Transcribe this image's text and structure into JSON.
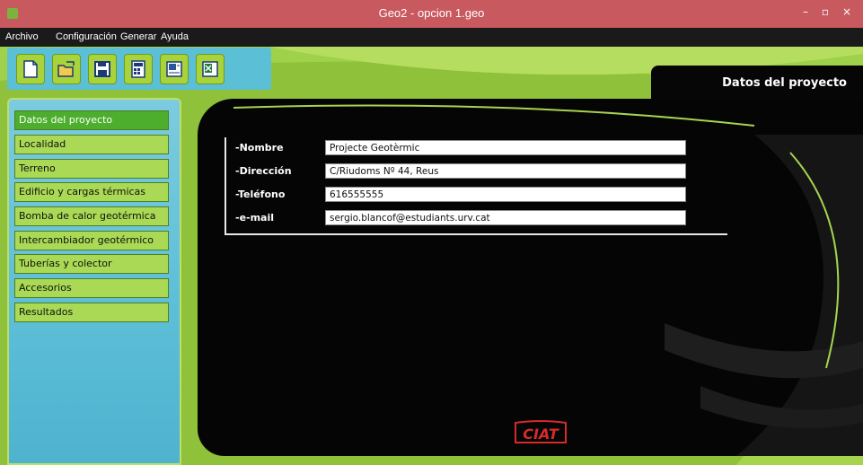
{
  "window": {
    "title": "Geo2 - opcion 1.geo"
  },
  "menu": [
    "Archivo",
    "Configuración",
    "Generar",
    "Ayuda"
  ],
  "toolbar": {
    "buttons": [
      "new-file-icon",
      "open-folder-icon",
      "save-icon",
      "calculator-icon",
      "word-export-icon",
      "excel-export-icon"
    ]
  },
  "section_tab": "Datos del proyecto",
  "sidebar": {
    "items": [
      "Datos del proyecto",
      "Localidad",
      "Terreno",
      "Edificio y cargas térmicas",
      "Bomba de calor geotérmica",
      "Intercambiador geotérmico",
      "Tuberías y colector",
      "Accesorios",
      "Resultados"
    ],
    "active_index": 0
  },
  "form": {
    "nombre_label": "-Nombre",
    "nombre_value": "Projecte Geotèrmic",
    "direccion_label": "-Dirección",
    "direccion_value": "C/Riudoms Nº 44, Reus",
    "telefono_label": "-Teléfono",
    "telefono_value": "616555555",
    "email_label": "-e-mail",
    "email_value": "sergio.blancof@estudiants.urv.cat"
  },
  "logo": "CIAT",
  "colors": {
    "titlebar": "#c8595f",
    "accent_green": "#8fc13a",
    "sidebar_blue": "#5ebfd8",
    "nav_active": "#4cae2c",
    "logo_red": "#d42b2b"
  }
}
